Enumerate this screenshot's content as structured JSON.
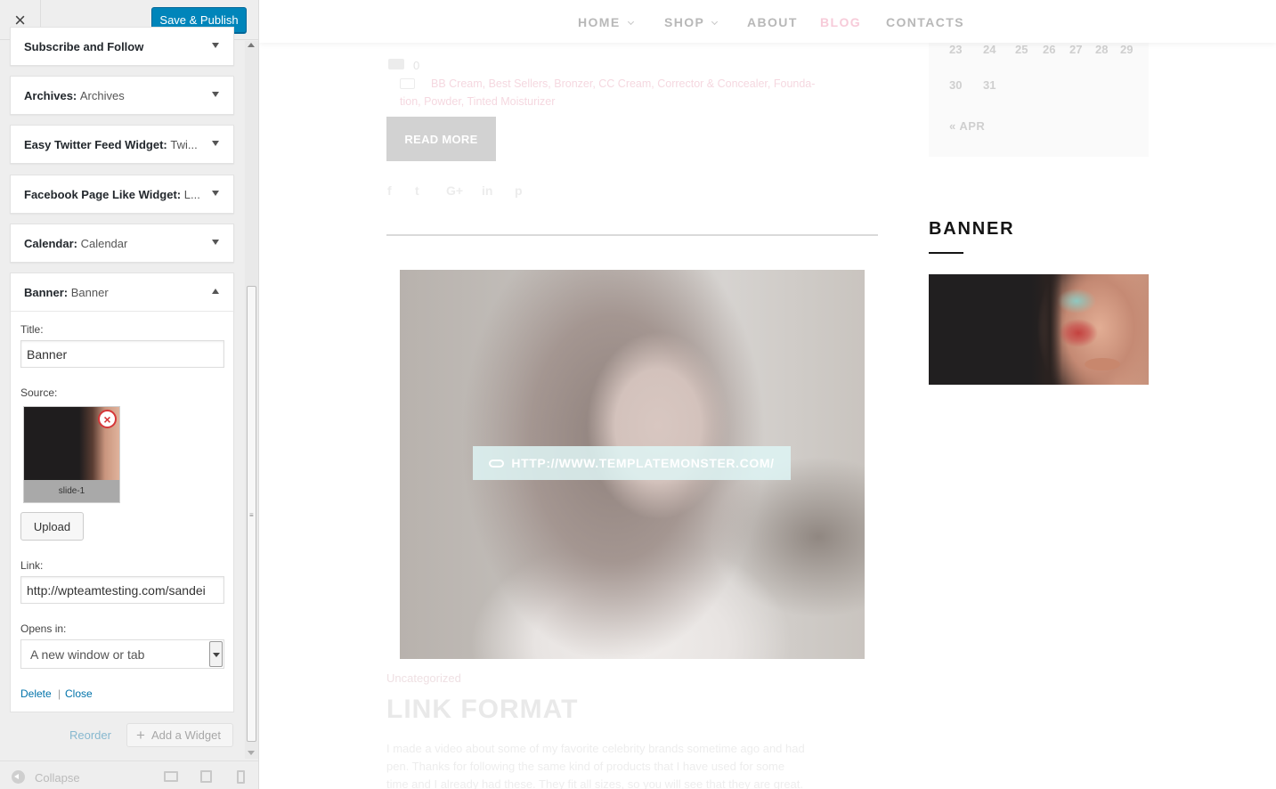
{
  "customizer": {
    "close_icon": "×",
    "save_label": "Save & Publish",
    "widgets": [
      {
        "name": "Subscribe and Follow",
        "title": "",
        "state": "collapsed"
      },
      {
        "name": "Archives:",
        "title": "Archives",
        "state": "collapsed"
      },
      {
        "name": "Easy Twitter Feed Widget:",
        "title": "Twi...",
        "state": "collapsed"
      },
      {
        "name": "Facebook Page Like Widget:",
        "title": "L...",
        "state": "collapsed"
      },
      {
        "name": "Calendar:",
        "title": "Calendar",
        "state": "collapsed"
      },
      {
        "name": "Banner:",
        "title": "Banner",
        "state": "expanded"
      }
    ],
    "banner_form": {
      "title_label": "Title:",
      "title_value": "Banner",
      "source_label": "Source:",
      "source_caption": "slide-1",
      "upload_label": "Upload",
      "link_label": "Link:",
      "link_value": "http://wpteamtesting.com/sandei",
      "opens_label": "Opens in:",
      "opens_value": "A new window or tab",
      "delete_label": "Delete",
      "separator": "|",
      "close_label": "Close"
    },
    "reorder_label": "Reorder",
    "add_widget_label": "Add a Widget",
    "collapse_label": "Collapse",
    "accent_color": "#0085ba"
  },
  "site": {
    "nav": [
      {
        "label": "HOME",
        "has_dropdown": true
      },
      {
        "label": "SHOP",
        "has_dropdown": true
      },
      {
        "label": "ABOUT",
        "has_dropdown": false
      },
      {
        "label": "BLOG",
        "has_dropdown": false,
        "active": true
      },
      {
        "label": "CONTACTS",
        "has_dropdown": false
      }
    ],
    "post_meta": {
      "comments": "0",
      "tags_line1": "BB Cream, Best Sellers, Bronzer, CC Cream, Corrector & Concealer, Founda-",
      "tags_line2": "tion, Powder, Tinted Moisturizer"
    },
    "read_more": "READ MORE",
    "social_icons": [
      "f",
      "t",
      "G+",
      "in",
      "p"
    ],
    "link_overlay": "HTTP://WWW.TEMPLATEMONSTER.COM/",
    "post_category": "Uncategorized",
    "post_title": "LINK FORMAT",
    "excerpt": [
      "I made a video about some of my favorite celebrity brands sometime ago and had",
      "pen. Thanks for following the same kind of products that I have used for some",
      "time and I already had these. They fit all sizes, so you will see that they are great."
    ],
    "calendar": {
      "rows": [
        [
          "23",
          "24",
          "25",
          "26",
          "27",
          "28",
          "29"
        ],
        [
          "30",
          "31"
        ]
      ],
      "prev_link": "« APR"
    },
    "banner_widget": {
      "heading": "BANNER"
    }
  }
}
